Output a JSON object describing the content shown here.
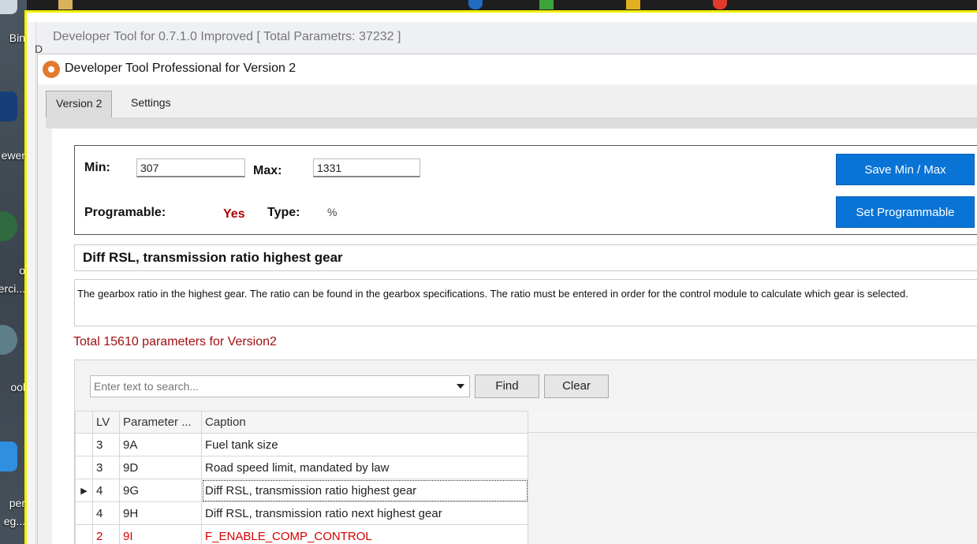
{
  "desktop": {
    "labels": [
      "Bin",
      "ewer",
      "o",
      "erci...",
      "ool",
      "per",
      "eg..."
    ]
  },
  "outer_window": {
    "left_letter": "D",
    "title": "Developer Tool for 0.7.1.0 Improved [ Total Parametrs: 37232 ]"
  },
  "inner_window": {
    "title": "Developer Tool Professional for Version 2"
  },
  "tabs": [
    {
      "label": "Version 2",
      "active": true
    },
    {
      "label": "Settings",
      "active": false
    }
  ],
  "minmax": {
    "min_label": "Min:",
    "min_value": "307",
    "max_label": "Max:",
    "max_value": "1331",
    "programable_label": "Programable:",
    "programable_value": "Yes",
    "type_label": "Type:",
    "type_value": "%",
    "save_button": "Save Min / Max",
    "set_prog_button": "Set Programmable"
  },
  "caption": "Diff RSL, transmission ratio highest gear",
  "description": "The gearbox ratio in the highest gear. The ratio can be found in the gearbox specifications. The ratio must be entered in order for the control module to calculate which gear is selected.",
  "total_text": "Total 15610 parameters for Version2",
  "search": {
    "placeholder": "Enter text to search...",
    "find_button": "Find",
    "clear_button": "Clear"
  },
  "grid": {
    "headers": [
      "LV",
      "Parameter ...",
      "Caption"
    ],
    "rows": [
      {
        "lv": "3",
        "param": "9A",
        "caption": "Fuel tank size",
        "selected": false,
        "red": false
      },
      {
        "lv": "3",
        "param": "9D",
        "caption": "Road speed limit, mandated by law",
        "selected": false,
        "red": false
      },
      {
        "lv": "4",
        "param": "9G",
        "caption": "Diff RSL, transmission ratio highest gear",
        "selected": true,
        "red": false
      },
      {
        "lv": "4",
        "param": "9H",
        "caption": "Diff RSL, transmission ratio next highest gear",
        "selected": false,
        "red": false
      },
      {
        "lv": "2",
        "param": "9I",
        "caption": "F_ENABLE_COMP_CONTROL",
        "selected": false,
        "red": true
      }
    ]
  },
  "colors": {
    "accent_blue": "#0a74d6",
    "highlight_red": "#b00000",
    "frame_yellow": "#f3f000"
  }
}
